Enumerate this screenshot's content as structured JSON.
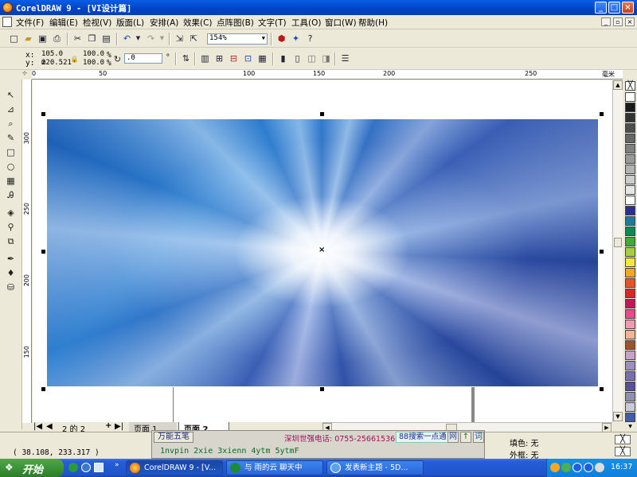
{
  "window": {
    "title": "CorelDRAW 9 - [VI设计篇]"
  },
  "menu": [
    "文件(F)",
    "编辑(E)",
    "检视(V)",
    "版面(L)",
    "安排(A)",
    "效果(C)",
    "点阵图(B)",
    "文字(T)",
    "工具(O)",
    "窗口(W)",
    "帮助(H)"
  ],
  "toolbar": {
    "zoom": "154%"
  },
  "propbar": {
    "x_label": "x:",
    "y_label": "y:",
    "x_value": "105.0 m",
    "y_value": "220.521",
    "scale_w": "100.0",
    "scale_h": "100.0",
    "pct": "%",
    "angle": ".0",
    "deg": "°"
  },
  "hruler": {
    "unit": "毫米",
    "ticks": [
      "0",
      "50",
      "100",
      "150",
      "200",
      "250"
    ]
  },
  "vruler": {
    "ticks": [
      "300",
      "250",
      "200",
      "150"
    ]
  },
  "pagenav": {
    "count": "2 的 2",
    "tab1": "页面 1",
    "tab2": "页面 2"
  },
  "status": {
    "coords": "( 38.108, 233.317 )",
    "fill": "填色: 无",
    "outline": "外框: 无"
  },
  "ime": {
    "mode": "万能五笔",
    "ad": "深圳世强电话: 0755-25661536",
    "search": "88搜索一点通",
    "btn_net": "网",
    "btn_arrow": "↑",
    "btn_word": "词",
    "candidates": "1nvpin 2xie 3xienn 4ytm 5ytmF"
  },
  "taskbar": {
    "start": "开始",
    "tasks": [
      "CorelDRAW 9 - [V...",
      "与 雨的云 聊天中",
      "发表新主题 - 5D..."
    ],
    "clock": "16:37"
  },
  "palette": [
    "#ffffff",
    "#1a1a1a",
    "#333333",
    "#4d4d4d",
    "#666666",
    "#808080",
    "#999999",
    "#b3b3b3",
    "#cccccc",
    "#e6e6e6",
    "#ffffff",
    "#2b2f8f",
    "#1f7a9e",
    "#0b8a58",
    "#3caa3c",
    "#a6cf3f",
    "#f2e83c",
    "#f5a623",
    "#e8542a",
    "#d8262a",
    "#c2185b",
    "#e84a8f",
    "#f19ab0",
    "#f5b39a",
    "#a0522d",
    "#c8a2c8",
    "#9e8fc2",
    "#7c6fb0",
    "#5a4f9c",
    "#8f8faf",
    "#c9c9dc",
    "#3e5fa8"
  ]
}
